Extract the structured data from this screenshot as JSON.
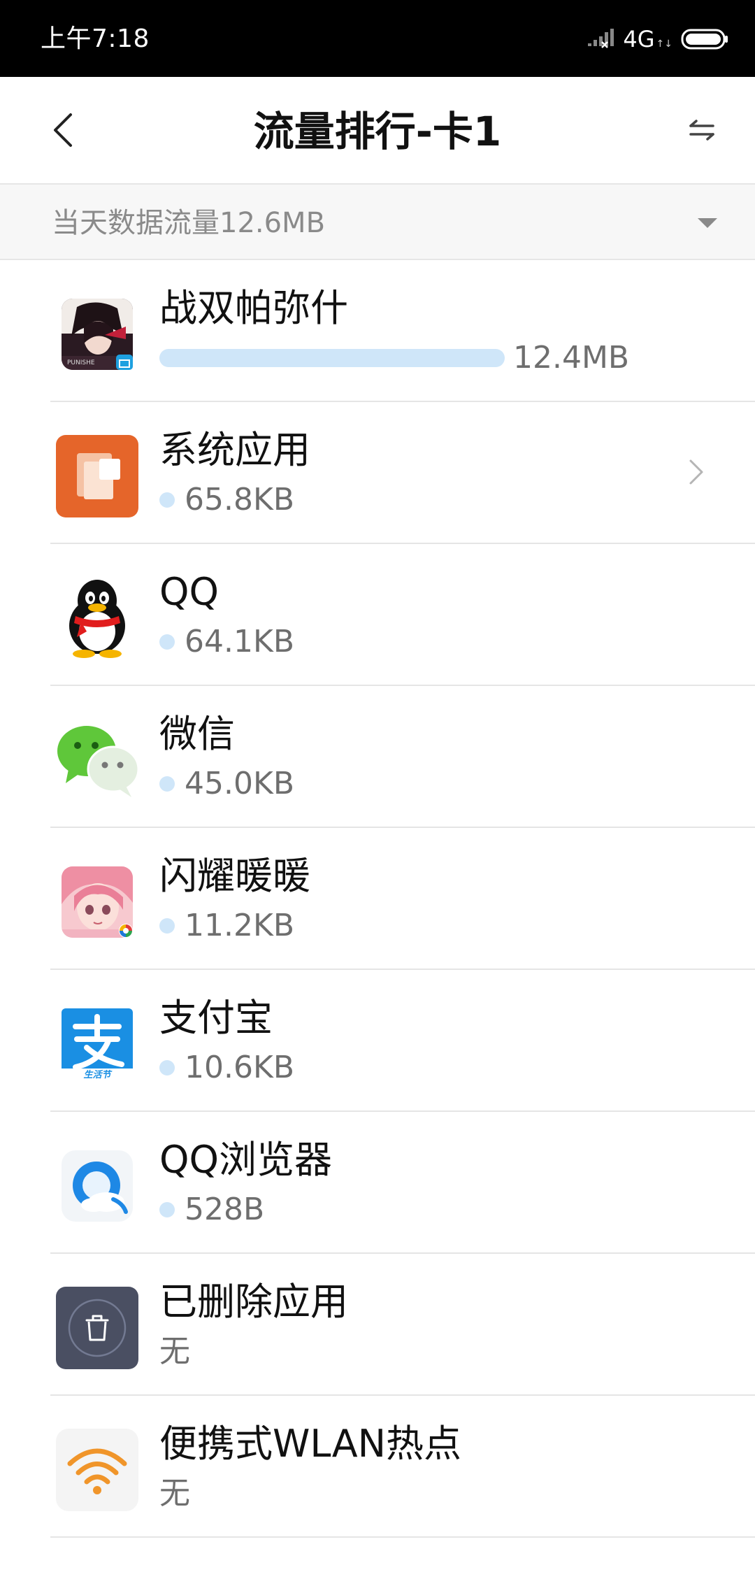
{
  "status_bar": {
    "time": "上午7:18",
    "network": "4G",
    "network_arrows": "↑↓"
  },
  "header": {
    "title": "流量排行-卡1"
  },
  "summary": {
    "text": "当天数据流量12.6MB"
  },
  "apps": [
    {
      "name": "战双帕弥什",
      "usage": "12.4MB",
      "icon": "punishing-gray-raven-icon",
      "bar_fraction": 1.0,
      "has_chevron": false
    },
    {
      "name": "系统应用",
      "usage": "65.8KB",
      "icon": "system-apps-icon",
      "has_chevron": true
    },
    {
      "name": "QQ",
      "usage": "64.1KB",
      "icon": "qq-penguin-icon",
      "has_chevron": false
    },
    {
      "name": "微信",
      "usage": "45.0KB",
      "icon": "wechat-icon",
      "has_chevron": false
    },
    {
      "name": "闪耀暖暖",
      "usage": "11.2KB",
      "icon": "shining-nikki-icon",
      "has_chevron": false
    },
    {
      "name": "支付宝",
      "usage": "10.6KB",
      "icon": "alipay-icon",
      "has_chevron": false
    },
    {
      "name": "QQ浏览器",
      "usage": "528B",
      "icon": "qq-browser-icon",
      "has_chevron": false
    },
    {
      "name": "已删除应用",
      "usage": "无",
      "icon": "deleted-apps-icon",
      "has_chevron": false
    },
    {
      "name": "便携式WLAN热点",
      "usage": "无",
      "icon": "wlan-hotspot-icon",
      "has_chevron": false
    }
  ],
  "icon_labels": {
    "alipay_caption": "生活节"
  },
  "colors": {
    "usage_bar": "#cfe6f9",
    "system_apps": "#e5652a",
    "wechat": "#5fc73a",
    "alipay": "#1a8fe3",
    "deleted_apps": "#4a4f62",
    "hotspot": "#f0952a"
  }
}
